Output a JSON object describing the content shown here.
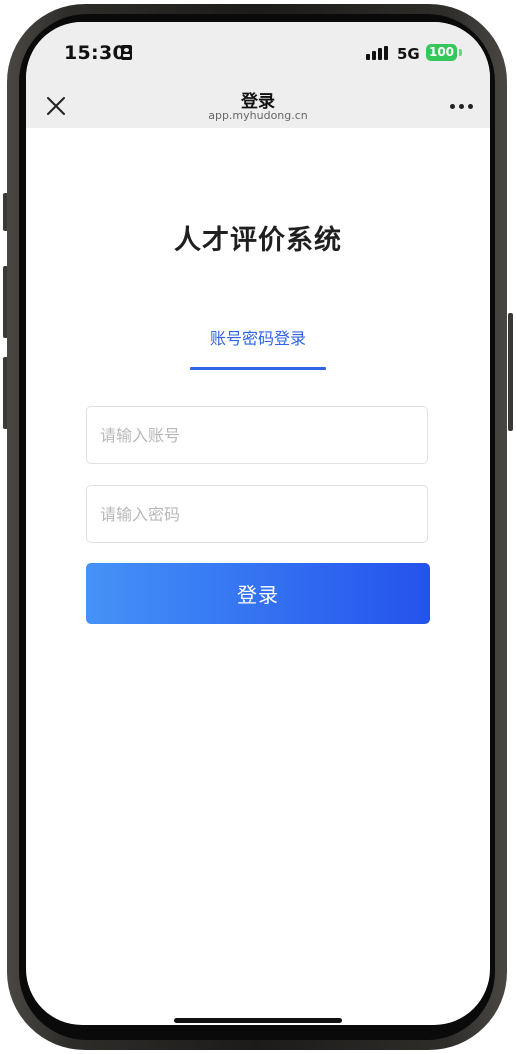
{
  "status_bar": {
    "time": "15:30",
    "network": "5G",
    "battery": "100",
    "icons": [
      "id-card-icon",
      "signal-icon",
      "battery-icon"
    ]
  },
  "nav": {
    "title": "登录",
    "url": "app.myhudong.cn",
    "icons": [
      "close-icon",
      "more-icon"
    ]
  },
  "page": {
    "title": "人才评价系统",
    "tabs": [
      {
        "label": "账号密码登录",
        "active": true
      }
    ],
    "account_field": {
      "placeholder": "请输入账号",
      "value": ""
    },
    "password_field": {
      "placeholder": "请输入密码",
      "value": ""
    },
    "login_button": "登录"
  },
  "colors": {
    "accent": "#2f63e8",
    "button_gradient_start": "#4592f7",
    "button_gradient_end": "#2453ec",
    "nav_background": "#eeeeee",
    "battery": "#35c759"
  }
}
